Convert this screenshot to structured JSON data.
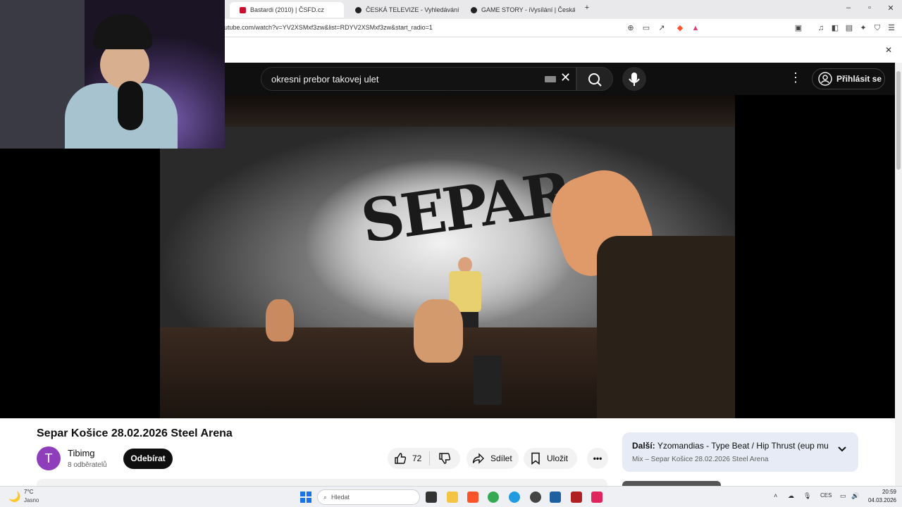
{
  "browser": {
    "tabs": [
      {
        "label": "Bastardi (2010) | ČSFD.cz",
        "favicon_color": "#c8102e"
      },
      {
        "label": "ČESKÁ TELEVIZE - Vyhledávání",
        "favicon_color": "#222222"
      },
      {
        "label": "GAME STORY - iVysílání | Česká telev",
        "favicon_color": "#222222"
      }
    ],
    "new_tab_label": "+",
    "url": "utube.com/watch?v=YV2XSMxf3zw&list=RDYV2XSMxf3zw&start_radio=1",
    "notification_close": "✕"
  },
  "youtube": {
    "search_query": "okresni prebor takovej ulet",
    "signin_label": "Přihlásit se",
    "video": {
      "title": "Separ Košice 28.02.2026 Steel Arena",
      "graffiti_text": "SEPAR"
    },
    "channel": {
      "avatar_letter": "T",
      "name": "Tibimg",
      "subscribers": "8 odběratelů",
      "subscribe_label": "Odebírat"
    },
    "actions": {
      "like_count": "72",
      "share_label": "Sdílet",
      "save_label": "Uložit"
    },
    "up_next": {
      "prefix": "Další:",
      "title": "Yzomandias - Type Beat / Hip Thrust (eup mu...",
      "mix_label": "Mix – Separ Košice 28.02.2026 Steel Arena"
    }
  },
  "taskbar": {
    "weather_temp": "7°C",
    "weather_desc": "Jasno",
    "search_placeholder": "Hledat",
    "language": "CES",
    "time": "20:59",
    "date": "04.03.2026"
  }
}
